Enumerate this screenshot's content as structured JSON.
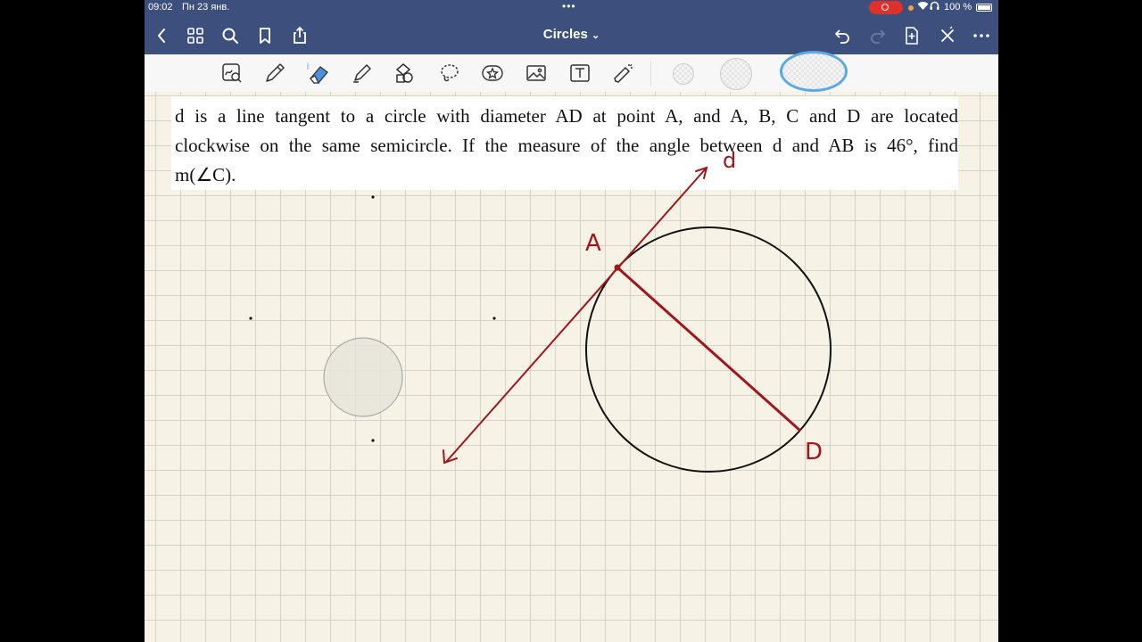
{
  "status": {
    "time": "09:02",
    "date": "Пн 23 янв.",
    "handle": "•••",
    "battery": "100 %"
  },
  "nav": {
    "title": "Circles",
    "title_chevron": "⌄"
  },
  "problem": {
    "line1": "d is a line tangent to a circle with diameter AD at point A, and A, B, C and D are located",
    "line2": "clockwise on the same semicircle. If the measure of the angle between d and AB is 46°, find",
    "line3": "m(∠C)."
  },
  "drawing": {
    "label_d": "d",
    "label_A": "A",
    "label_D": "D",
    "ink_color": "#a0161b"
  },
  "colors": {
    "nav_bg": "#3d4f7c",
    "page_bg": "#f6f3e6",
    "accent": "#5aa8e6"
  }
}
